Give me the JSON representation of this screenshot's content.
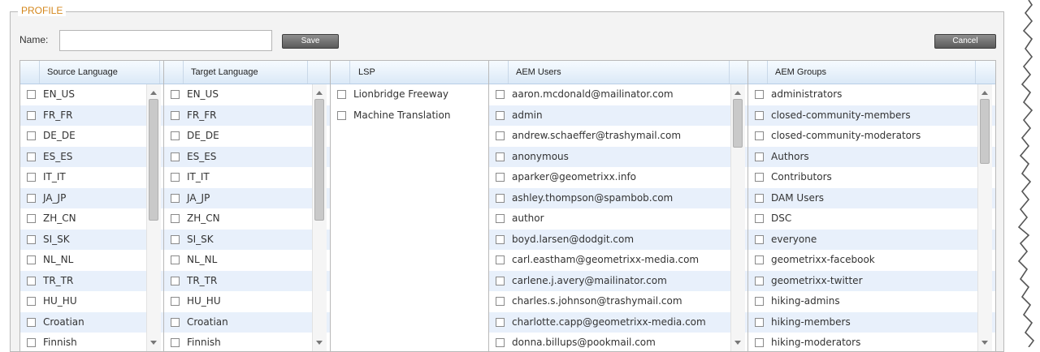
{
  "profile": {
    "legend": "PROFILE",
    "name_label": "Name:",
    "name_value": "",
    "save_label": "Save",
    "cancel_label": "Cancel"
  },
  "panels": {
    "source_language": {
      "header": "Source Language",
      "items": [
        "EN_US",
        "FR_FR",
        "DE_DE",
        "ES_ES",
        "IT_IT",
        "JA_JP",
        "ZH_CN",
        "SI_SK",
        "NL_NL",
        "TR_TR",
        "HU_HU",
        "Croatian",
        "Finnish"
      ]
    },
    "target_language": {
      "header": "Target Language",
      "items": [
        "EN_US",
        "FR_FR",
        "DE_DE",
        "ES_ES",
        "IT_IT",
        "JA_JP",
        "ZH_CN",
        "SI_SK",
        "NL_NL",
        "TR_TR",
        "HU_HU",
        "Croatian",
        "Finnish"
      ]
    },
    "lsp": {
      "header": "LSP",
      "items": [
        "Lionbridge Freeway",
        "Machine Translation"
      ]
    },
    "aem_users": {
      "header": "AEM Users",
      "items": [
        "aaron.mcdonald@mailinator.com",
        "admin",
        "andrew.schaeffer@trashymail.com",
        "anonymous",
        "aparker@geometrixx.info",
        "ashley.thompson@spambob.com",
        "author",
        "boyd.larsen@dodgit.com",
        "carl.eastham@geometrixx-media.com",
        "carlene.j.avery@mailinator.com",
        "charles.s.johnson@trashymail.com",
        "charlotte.capp@geometrixx-media.com",
        "donna.billups@pookmail.com"
      ]
    },
    "aem_groups": {
      "header": "AEM Groups",
      "items": [
        "administrators",
        "closed-community-members",
        "closed-community-moderators",
        "Authors",
        "Contributors",
        "DAM Users",
        "DSC",
        "everyone",
        "geometrixx-facebook",
        "geometrixx-twitter",
        "hiking-admins",
        "hiking-members",
        "hiking-moderators"
      ]
    }
  },
  "icons": {
    "checkbox": "checkbox-icon",
    "scroll_up": "scroll-up-arrow-icon",
    "scroll_down": "scroll-down-arrow-icon"
  },
  "colors": {
    "legend": "#d4871c",
    "header_bg": "#dbe9f7",
    "row_alt_bg": "#e8f0fb",
    "button_bg": "#6e6e6e"
  }
}
